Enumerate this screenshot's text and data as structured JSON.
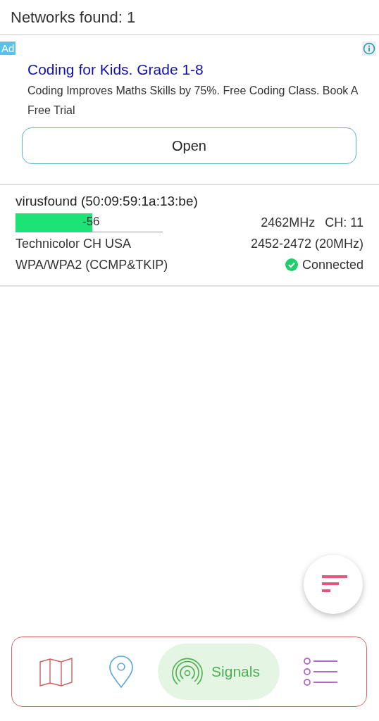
{
  "header": {
    "title": "Networks found: 1"
  },
  "ad": {
    "badge": "Ad",
    "title": "Coding for Kids. Grade 1-8",
    "description": "Coding Improves Maths Skills by 75%. Free Coding Class. Book A Free Trial",
    "button": "Open"
  },
  "networks": [
    {
      "name": "virusfound (50:09:59:1a:13:be)",
      "level": 0.52,
      "signal": "-56",
      "frequency": "2462MHz",
      "channel": "CH: 11",
      "vendor": "Technicolor CH USA",
      "range": "2452-2472 (20MHz)",
      "security": "WPA/WPA2 (CCMP&TKIP)",
      "connected": true,
      "status": "Connected"
    }
  ],
  "nav": [
    {
      "kind": "map",
      "selected": false
    },
    {
      "kind": "location",
      "selected": false
    },
    {
      "kind": "signals",
      "selected": true,
      "label": "Signals"
    },
    {
      "kind": "list",
      "selected": false
    }
  ]
}
